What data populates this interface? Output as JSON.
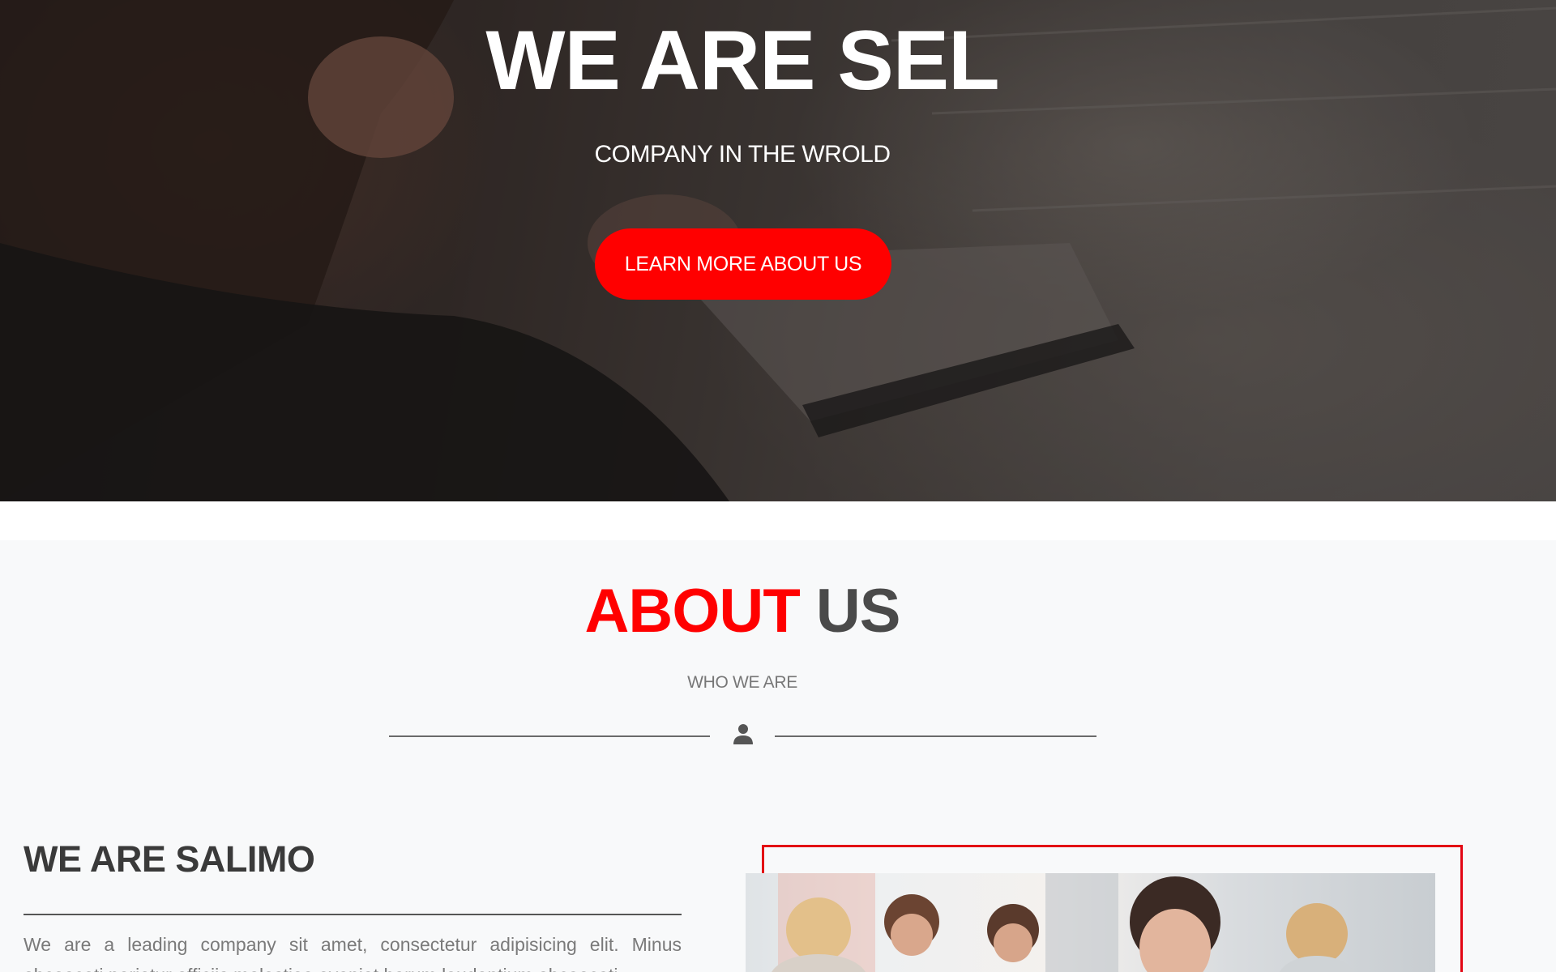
{
  "hero": {
    "title": "WE ARE SEL",
    "subtitle": "COMPANY IN THE WROLD",
    "cta_label": "LEARN MORE ABOUT US"
  },
  "about": {
    "heading_accent": "ABOUT",
    "heading_rest": "US",
    "subheading": "WHO WE ARE",
    "divider_icon": "user-icon",
    "intro_title_light": "WE ARE",
    "intro_title_bold": "SALIMO",
    "intro_text": "We are a leading company sit amet, consectetur adipisicing elit. Minus obcaecati pariatur officiis molestiae eveniet harum laudantium obcaecati"
  },
  "colors": {
    "accent": "#ff0000",
    "heading_dark": "#4a4a4a",
    "background": "#f8f9fa",
    "frame": "#e30613"
  }
}
